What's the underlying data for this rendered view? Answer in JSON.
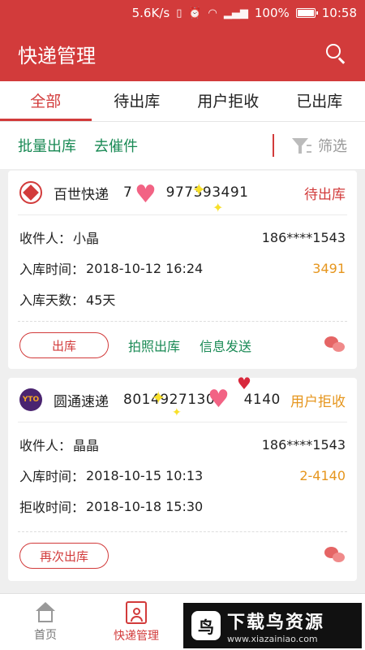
{
  "statusbar": {
    "speed": "5.6K/s",
    "battery": "100%",
    "time": "10:58",
    "icons": [
      "vibrate-icon",
      "alarm-icon",
      "wifi-icon",
      "signal-icon",
      "battery-icon"
    ]
  },
  "appbar": {
    "title": "快递管理",
    "search_icon": "search-icon"
  },
  "tabs": [
    {
      "label": "全部"
    },
    {
      "label": "待出库"
    },
    {
      "label": "用户拒收"
    },
    {
      "label": "已出库"
    }
  ],
  "toolbar": {
    "batch_out": "批量出库",
    "urge": "去催件",
    "filter": "筛选"
  },
  "cards": [
    {
      "carrier": "百世快递",
      "tracking": "7       977393491",
      "status": "待出库",
      "recipient_label": "收件人：",
      "recipient": "小晶",
      "phone": "186****1543",
      "time_label": "入库时间：",
      "time": "2018-10-12 16:24",
      "code": "3491",
      "extra_label": "入库天数：",
      "extra": "45天",
      "btn_out": "出库",
      "photo_out": "拍照出库",
      "send_msg": "信息发送"
    },
    {
      "carrier": "圆通速递",
      "tracking": "8014927130      4140",
      "status": "用户拒收",
      "recipient_label": "收件人：",
      "recipient": "晶晶",
      "phone": "186****1543",
      "time_label": "入库时间：",
      "time": "2018-10-15 10:13",
      "code": "2-4140",
      "extra_label": "拒收时间：",
      "extra": "2018-10-18 15:30",
      "btn_out": "再次出库"
    }
  ],
  "bottomnav": [
    {
      "label": "首页"
    },
    {
      "label": "快递管理"
    }
  ],
  "watermark": {
    "title": "下载鸟资源",
    "url": "www.xiazainiao.com"
  }
}
